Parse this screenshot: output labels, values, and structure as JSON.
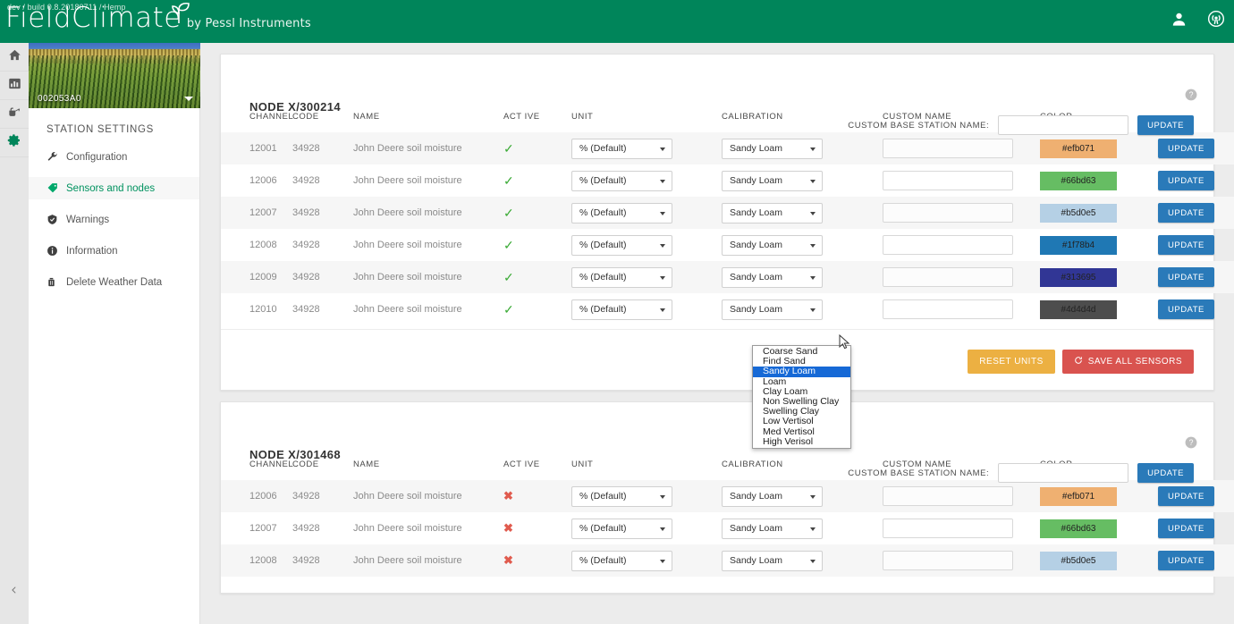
{
  "topbar": {
    "build_text": "dev / build 0.8.20180711 / Hemp",
    "brand": "FieldClimate",
    "brand_suffix": "by Pessl Instruments",
    "brand_color": "#00855a",
    "icons": [
      "user-icon",
      "signal-icon"
    ]
  },
  "rail": {
    "items": [
      {
        "name": "home-icon",
        "active": false
      },
      {
        "name": "chart-icon",
        "active": false
      },
      {
        "name": "irrigation-icon",
        "active": false
      },
      {
        "name": "gear-icon",
        "active": true
      }
    ],
    "collapse_icon": "chevron-left-icon"
  },
  "station": {
    "id": "002053A0",
    "settings_title": "STATION SETTINGS",
    "items": [
      {
        "label": "Configuration",
        "icon": "wrench-icon",
        "active": false
      },
      {
        "label": "Sensors and nodes",
        "icon": "tag-icon",
        "active": true
      },
      {
        "label": "Warnings",
        "icon": "shield-icon",
        "active": false
      },
      {
        "label": "Information",
        "icon": "info-icon",
        "active": false
      },
      {
        "label": "Delete Weather Data",
        "icon": "trash-icon",
        "active": false
      }
    ]
  },
  "common": {
    "base_station_label": "CUSTOM BASE STATION NAME:",
    "base_station_value": "",
    "base_station_placeholder": "",
    "update_label": "UPDATE",
    "reset_units_label": "RESET UNITS",
    "save_all_label": "SAVE ALL SENSORS",
    "help_icon": "help-icon",
    "columns": [
      "CHANNEL",
      "CODE",
      "NAME",
      "ACT IVE",
      "UNIT",
      "CALIBRATION",
      "CUSTOM NAME",
      "COLOR"
    ],
    "unit_value": "% (Default)",
    "calibration_value": "Sandy Loam",
    "custom_name_value": "",
    "accent_blue": "#2a7ab9",
    "accent_green": "#3aaa35",
    "accent_red": "#e05b4e",
    "reset_color": "#ecb042",
    "save_color": "#d9534f"
  },
  "calibration_options": [
    "Coarse Sand",
    "Find Sand",
    "Sandy Loam",
    "Loam",
    "Clay Loam",
    "Non Swelling Clay",
    "Swelling Clay",
    "Low Vertisol",
    "Med Vertisol",
    "High Verisol"
  ],
  "calibration_selected": "Sandy Loam",
  "nodes": [
    {
      "title": "NODE X/300214",
      "rows": [
        {
          "channel": "12001",
          "code": "34928",
          "name": "John Deere soil moisture",
          "active": true,
          "unit": "% (Default)",
          "calibration": "Sandy Loam",
          "custom_name": "",
          "color": "#efb071",
          "color_label": "#efb071",
          "update": "UPDATE"
        },
        {
          "channel": "12006",
          "code": "34928",
          "name": "John Deere soil moisture",
          "active": true,
          "unit": "% (Default)",
          "calibration": "Sandy Loam",
          "custom_name": "",
          "color": "#66bd63",
          "color_label": "#66bd63",
          "update": "UPDATE"
        },
        {
          "channel": "12007",
          "code": "34928",
          "name": "John Deere soil moisture",
          "active": true,
          "unit": "% (Default)",
          "calibration": "Sandy Loam",
          "custom_name": "",
          "color": "#b5d0e5",
          "color_label": "#b5d0e5",
          "update": "UPDATE"
        },
        {
          "channel": "12008",
          "code": "34928",
          "name": "John Deere soil moisture",
          "active": true,
          "unit": "% (Default)",
          "calibration": "Sandy Loam",
          "custom_name": "",
          "color": "#1f78b4",
          "color_label": "#1f78b4",
          "update": "UPDATE"
        },
        {
          "channel": "12009",
          "code": "34928",
          "name": "John Deere soil moisture",
          "active": true,
          "unit": "% (Default)",
          "calibration": "Sandy Loam",
          "custom_name": "",
          "color": "#313695",
          "color_label": "#313695",
          "update": "UPDATE"
        },
        {
          "channel": "12010",
          "code": "34928",
          "name": "John Deere soil moisture",
          "active": true,
          "unit": "% (Default)",
          "calibration": "Sandy Loam",
          "custom_name": "",
          "color": "#4d4d4d",
          "color_label": "#4d4d4d",
          "update": "UPDATE"
        }
      ]
    },
    {
      "title": "NODE X/301468",
      "rows": [
        {
          "channel": "12006",
          "code": "34928",
          "name": "John Deere soil moisture",
          "active": false,
          "unit": "% (Default)",
          "calibration": "Sandy Loam",
          "custom_name": "",
          "color": "#efb071",
          "color_label": "#efb071",
          "update": "UPDATE"
        },
        {
          "channel": "12007",
          "code": "34928",
          "name": "John Deere soil moisture",
          "active": false,
          "unit": "% (Default)",
          "calibration": "Sandy Loam",
          "custom_name": "",
          "color": "#66bd63",
          "color_label": "#66bd63",
          "update": "UPDATE"
        },
        {
          "channel": "12008",
          "code": "34928",
          "name": "John Deere soil moisture",
          "active": false,
          "unit": "% (Default)",
          "calibration": "Sandy Loam",
          "custom_name": "",
          "color": "#b5d0e5",
          "color_label": "#b5d0e5",
          "update": "UPDATE"
        }
      ]
    }
  ]
}
